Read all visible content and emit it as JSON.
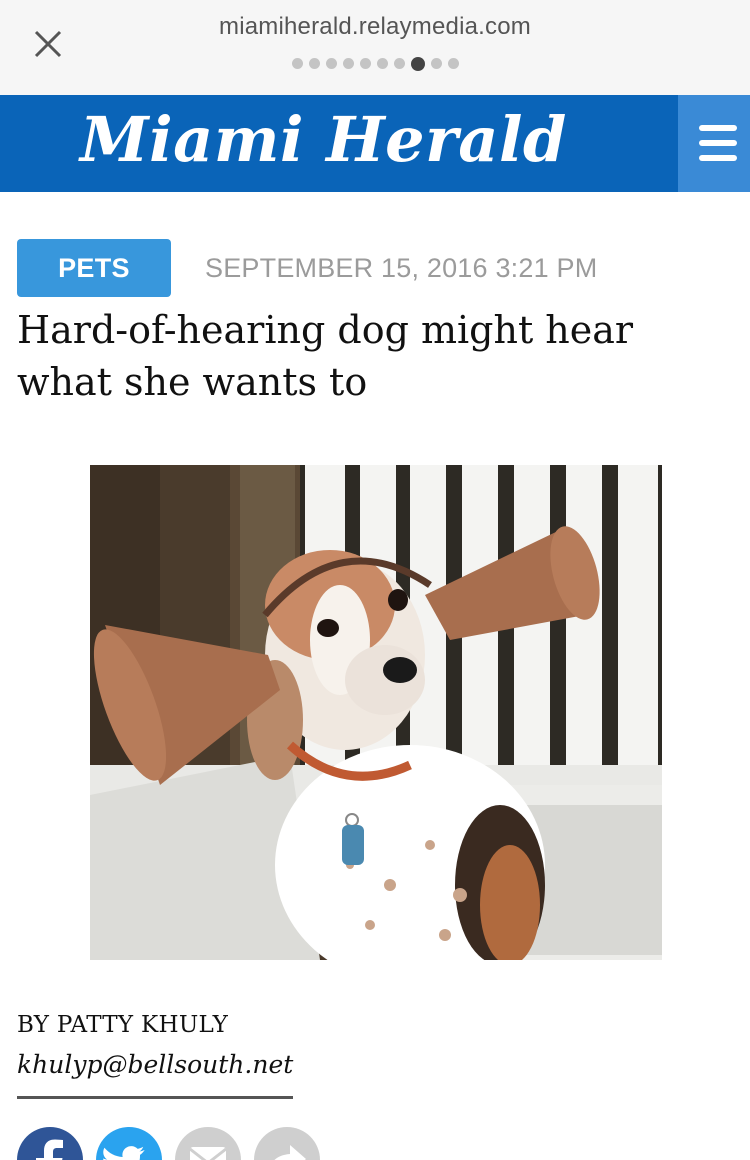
{
  "browser": {
    "url": "miamiherald.relaymedia.com",
    "page_dots_total": 10,
    "page_dots_active_index": 7
  },
  "masthead": {
    "logo_text": "Miami Herald",
    "brand_color": "#0a64b8"
  },
  "article": {
    "category": "PETS",
    "date": "SEPTEMBER 15, 2016 3:21 PM",
    "headline": "Hard-of-hearing dog might hear what she wants to",
    "byline": "BY PATTY KHULY",
    "author_email": "khulyp@bellsouth.net"
  },
  "share_icons": [
    "facebook-icon",
    "twitter-icon",
    "email-icon",
    "forward-icon"
  ],
  "colors": {
    "badge": "#3897dc",
    "facebook": "#2f5597",
    "twitter": "#2aa3ef",
    "neutral_icon": "#cfcfcf"
  }
}
